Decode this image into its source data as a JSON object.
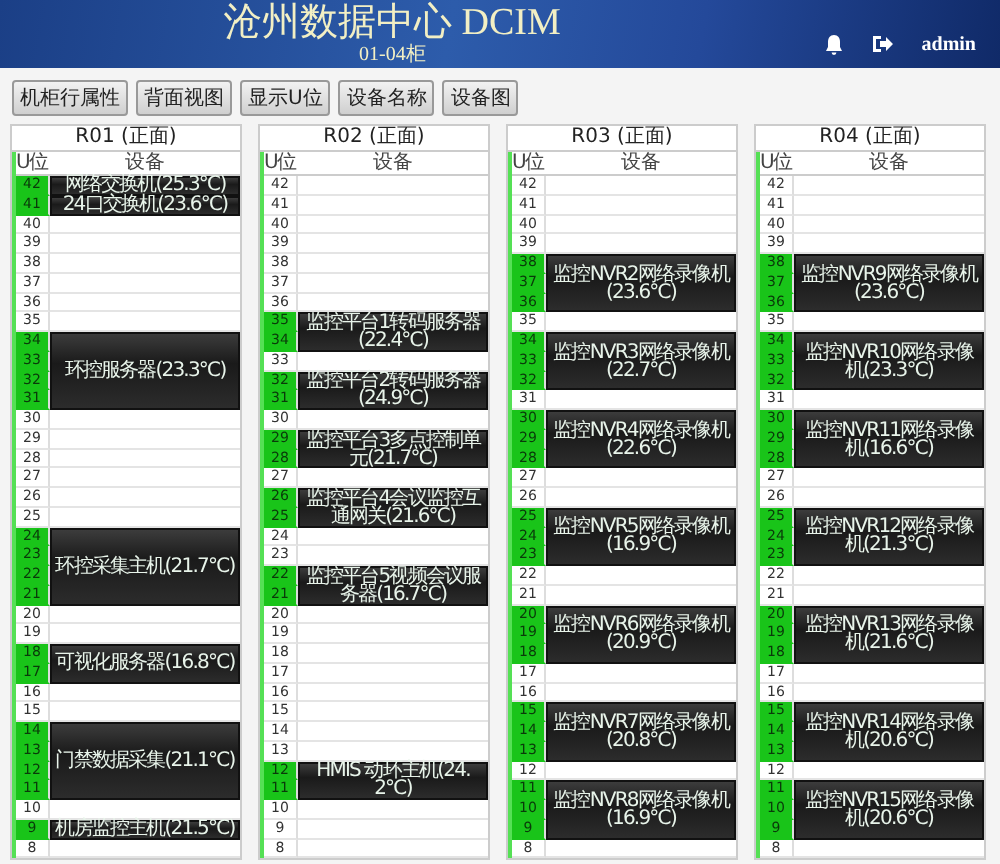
{
  "header": {
    "title": "沧州数据中心 DCIM",
    "subtitle": "01-04柜",
    "user": "admin"
  },
  "toolbar": [
    "机柜行属性",
    "背面视图",
    "显示U位",
    "设备名称",
    "设备图"
  ],
  "racks": [
    {
      "title": "R01 (正面)",
      "u_header": "U位",
      "device_header": "设备",
      "segments": [
        {
          "kind": "device",
          "name": "网络交换机(25.3℃)",
          "units": [
            "42"
          ]
        },
        {
          "kind": "device",
          "name": "24口交换机(23.6℃)",
          "units": [
            "41"
          ]
        },
        {
          "kind": "empty",
          "units": [
            "40",
            "39",
            "38",
            "37",
            "36",
            "35"
          ]
        },
        {
          "kind": "device",
          "name": "环控服务器(23.3℃)",
          "units": [
            "34",
            "33",
            "32",
            "31"
          ]
        },
        {
          "kind": "empty",
          "units": [
            "30",
            "29",
            "28",
            "27",
            "26",
            "25"
          ]
        },
        {
          "kind": "device",
          "name": "环控采集主机(21.7℃)",
          "units": [
            "24",
            "23",
            "22",
            "21"
          ]
        },
        {
          "kind": "empty",
          "units": [
            "20",
            "19"
          ]
        },
        {
          "kind": "device",
          "name": "可视化服务器(16.8℃)",
          "units": [
            "18",
            "17"
          ]
        },
        {
          "kind": "empty",
          "units": [
            "16",
            "15"
          ]
        },
        {
          "kind": "device",
          "name": "门禁数据采集(21.1℃)",
          "units": [
            "14",
            "13",
            "12",
            "11"
          ]
        },
        {
          "kind": "empty",
          "units": [
            "10"
          ]
        },
        {
          "kind": "device",
          "name": "机房监控主机(21.5℃)",
          "units": [
            "9"
          ]
        },
        {
          "kind": "empty",
          "units": [
            "8"
          ]
        }
      ]
    },
    {
      "title": "R02 (正面)",
      "u_header": "U位",
      "device_header": "设备",
      "segments": [
        {
          "kind": "empty",
          "units": [
            "42",
            "41",
            "40",
            "39",
            "38",
            "37",
            "36"
          ]
        },
        {
          "kind": "device",
          "name": "监控平台1转码服务器(22.4℃)",
          "units": [
            "35",
            "34"
          ]
        },
        {
          "kind": "empty",
          "units": [
            "33"
          ]
        },
        {
          "kind": "device",
          "name": "监控平台2转码服务器(24.9℃)",
          "units": [
            "32",
            "31"
          ]
        },
        {
          "kind": "empty",
          "units": [
            "30"
          ]
        },
        {
          "kind": "device",
          "name": "监控平台3多点控制单元(21.7℃)",
          "units": [
            "29",
            "28"
          ]
        },
        {
          "kind": "empty",
          "units": [
            "27"
          ]
        },
        {
          "kind": "device",
          "name": "监控平台4会议监控互通网关(21.6℃)",
          "units": [
            "26",
            "25"
          ]
        },
        {
          "kind": "empty",
          "units": [
            "24",
            "23"
          ]
        },
        {
          "kind": "device",
          "name": "监控平台5视频会议服务器(16.7℃)",
          "units": [
            "22",
            "21"
          ]
        },
        {
          "kind": "empty",
          "units": [
            "20",
            "19",
            "18",
            "17",
            "16",
            "15",
            "14",
            "13"
          ]
        },
        {
          "kind": "device",
          "name": "HMIS 动环主机(24.2℃)",
          "units": [
            "12",
            "11"
          ]
        },
        {
          "kind": "empty",
          "units": [
            "10",
            "9",
            "8"
          ]
        }
      ]
    },
    {
      "title": "R03 (正面)",
      "u_header": "U位",
      "device_header": "设备",
      "segments": [
        {
          "kind": "empty",
          "units": [
            "42",
            "41",
            "40",
            "39"
          ]
        },
        {
          "kind": "device",
          "name": "监控NVR2网络录像机(23.6℃)",
          "units": [
            "38",
            "37",
            "36"
          ]
        },
        {
          "kind": "empty",
          "units": [
            "35"
          ]
        },
        {
          "kind": "device",
          "name": "监控NVR3网络录像机(22.7℃)",
          "units": [
            "34",
            "33",
            "32"
          ]
        },
        {
          "kind": "empty",
          "units": [
            "31"
          ]
        },
        {
          "kind": "device",
          "name": "监控NVR4网络录像机(22.6℃)",
          "units": [
            "30",
            "29",
            "28"
          ]
        },
        {
          "kind": "empty",
          "units": [
            "27",
            "26"
          ]
        },
        {
          "kind": "device",
          "name": "监控NVR5网络录像机(16.9℃)",
          "units": [
            "25",
            "24",
            "23"
          ]
        },
        {
          "kind": "empty",
          "units": [
            "22",
            "21"
          ]
        },
        {
          "kind": "device",
          "name": "监控NVR6网络录像机(20.9℃)",
          "units": [
            "20",
            "19",
            "18"
          ]
        },
        {
          "kind": "empty",
          "units": [
            "17",
            "16"
          ]
        },
        {
          "kind": "device",
          "name": "监控NVR7网络录像机(20.8℃)",
          "units": [
            "15",
            "14",
            "13"
          ]
        },
        {
          "kind": "empty",
          "units": [
            "12"
          ]
        },
        {
          "kind": "device",
          "name": "监控NVR8网络录像机(16.9℃)",
          "units": [
            "11",
            "10",
            "9"
          ]
        },
        {
          "kind": "empty",
          "units": [
            "8"
          ]
        }
      ]
    },
    {
      "title": "R04 (正面)",
      "u_header": "U位",
      "device_header": "设备",
      "segments": [
        {
          "kind": "empty",
          "units": [
            "42",
            "41",
            "40",
            "39"
          ]
        },
        {
          "kind": "device",
          "name": "监控NVR9网络录像机(23.6℃)",
          "units": [
            "38",
            "37",
            "36"
          ]
        },
        {
          "kind": "empty",
          "units": [
            "35"
          ]
        },
        {
          "kind": "device",
          "name": "监控NVR10网络录像机(23.3℃)",
          "units": [
            "34",
            "33",
            "32"
          ]
        },
        {
          "kind": "empty",
          "units": [
            "31"
          ]
        },
        {
          "kind": "device",
          "name": "监控NVR11网络录像机(16.6℃)",
          "units": [
            "30",
            "29",
            "28"
          ]
        },
        {
          "kind": "empty",
          "units": [
            "27",
            "26"
          ]
        },
        {
          "kind": "device",
          "name": "监控NVR12网络录像机(21.3℃)",
          "units": [
            "25",
            "24",
            "23"
          ]
        },
        {
          "kind": "empty",
          "units": [
            "22",
            "21"
          ]
        },
        {
          "kind": "device",
          "name": "监控NVR13网络录像机(21.6℃)",
          "units": [
            "20",
            "19",
            "18"
          ]
        },
        {
          "kind": "empty",
          "units": [
            "17",
            "16"
          ]
        },
        {
          "kind": "device",
          "name": "监控NVR14网络录像机(20.6℃)",
          "units": [
            "15",
            "14",
            "13"
          ]
        },
        {
          "kind": "empty",
          "units": [
            "12"
          ]
        },
        {
          "kind": "device",
          "name": "监控NVR15网络录像机(20.6℃)",
          "units": [
            "11",
            "10",
            "9"
          ]
        },
        {
          "kind": "empty",
          "units": [
            "8"
          ]
        }
      ]
    }
  ]
}
